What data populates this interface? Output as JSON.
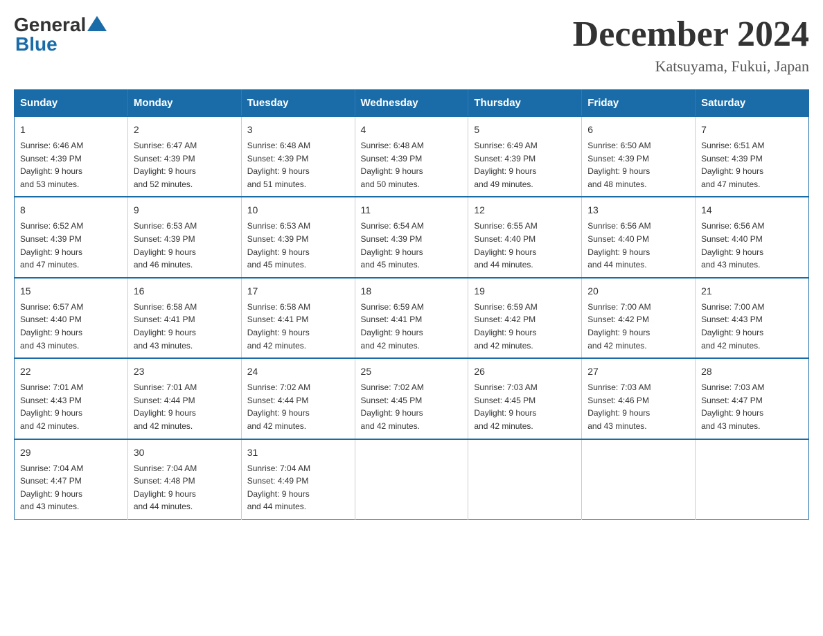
{
  "logo": {
    "general": "General",
    "blue": "Blue"
  },
  "title": "December 2024",
  "location": "Katsuyama, Fukui, Japan",
  "headers": [
    "Sunday",
    "Monday",
    "Tuesday",
    "Wednesday",
    "Thursday",
    "Friday",
    "Saturday"
  ],
  "weeks": [
    [
      {
        "day": "1",
        "info": "Sunrise: 6:46 AM\nSunset: 4:39 PM\nDaylight: 9 hours\nand 53 minutes."
      },
      {
        "day": "2",
        "info": "Sunrise: 6:47 AM\nSunset: 4:39 PM\nDaylight: 9 hours\nand 52 minutes."
      },
      {
        "day": "3",
        "info": "Sunrise: 6:48 AM\nSunset: 4:39 PM\nDaylight: 9 hours\nand 51 minutes."
      },
      {
        "day": "4",
        "info": "Sunrise: 6:48 AM\nSunset: 4:39 PM\nDaylight: 9 hours\nand 50 minutes."
      },
      {
        "day": "5",
        "info": "Sunrise: 6:49 AM\nSunset: 4:39 PM\nDaylight: 9 hours\nand 49 minutes."
      },
      {
        "day": "6",
        "info": "Sunrise: 6:50 AM\nSunset: 4:39 PM\nDaylight: 9 hours\nand 48 minutes."
      },
      {
        "day": "7",
        "info": "Sunrise: 6:51 AM\nSunset: 4:39 PM\nDaylight: 9 hours\nand 47 minutes."
      }
    ],
    [
      {
        "day": "8",
        "info": "Sunrise: 6:52 AM\nSunset: 4:39 PM\nDaylight: 9 hours\nand 47 minutes."
      },
      {
        "day": "9",
        "info": "Sunrise: 6:53 AM\nSunset: 4:39 PM\nDaylight: 9 hours\nand 46 minutes."
      },
      {
        "day": "10",
        "info": "Sunrise: 6:53 AM\nSunset: 4:39 PM\nDaylight: 9 hours\nand 45 minutes."
      },
      {
        "day": "11",
        "info": "Sunrise: 6:54 AM\nSunset: 4:39 PM\nDaylight: 9 hours\nand 45 minutes."
      },
      {
        "day": "12",
        "info": "Sunrise: 6:55 AM\nSunset: 4:40 PM\nDaylight: 9 hours\nand 44 minutes."
      },
      {
        "day": "13",
        "info": "Sunrise: 6:56 AM\nSunset: 4:40 PM\nDaylight: 9 hours\nand 44 minutes."
      },
      {
        "day": "14",
        "info": "Sunrise: 6:56 AM\nSunset: 4:40 PM\nDaylight: 9 hours\nand 43 minutes."
      }
    ],
    [
      {
        "day": "15",
        "info": "Sunrise: 6:57 AM\nSunset: 4:40 PM\nDaylight: 9 hours\nand 43 minutes."
      },
      {
        "day": "16",
        "info": "Sunrise: 6:58 AM\nSunset: 4:41 PM\nDaylight: 9 hours\nand 43 minutes."
      },
      {
        "day": "17",
        "info": "Sunrise: 6:58 AM\nSunset: 4:41 PM\nDaylight: 9 hours\nand 42 minutes."
      },
      {
        "day": "18",
        "info": "Sunrise: 6:59 AM\nSunset: 4:41 PM\nDaylight: 9 hours\nand 42 minutes."
      },
      {
        "day": "19",
        "info": "Sunrise: 6:59 AM\nSunset: 4:42 PM\nDaylight: 9 hours\nand 42 minutes."
      },
      {
        "day": "20",
        "info": "Sunrise: 7:00 AM\nSunset: 4:42 PM\nDaylight: 9 hours\nand 42 minutes."
      },
      {
        "day": "21",
        "info": "Sunrise: 7:00 AM\nSunset: 4:43 PM\nDaylight: 9 hours\nand 42 minutes."
      }
    ],
    [
      {
        "day": "22",
        "info": "Sunrise: 7:01 AM\nSunset: 4:43 PM\nDaylight: 9 hours\nand 42 minutes."
      },
      {
        "day": "23",
        "info": "Sunrise: 7:01 AM\nSunset: 4:44 PM\nDaylight: 9 hours\nand 42 minutes."
      },
      {
        "day": "24",
        "info": "Sunrise: 7:02 AM\nSunset: 4:44 PM\nDaylight: 9 hours\nand 42 minutes."
      },
      {
        "day": "25",
        "info": "Sunrise: 7:02 AM\nSunset: 4:45 PM\nDaylight: 9 hours\nand 42 minutes."
      },
      {
        "day": "26",
        "info": "Sunrise: 7:03 AM\nSunset: 4:45 PM\nDaylight: 9 hours\nand 42 minutes."
      },
      {
        "day": "27",
        "info": "Sunrise: 7:03 AM\nSunset: 4:46 PM\nDaylight: 9 hours\nand 43 minutes."
      },
      {
        "day": "28",
        "info": "Sunrise: 7:03 AM\nSunset: 4:47 PM\nDaylight: 9 hours\nand 43 minutes."
      }
    ],
    [
      {
        "day": "29",
        "info": "Sunrise: 7:04 AM\nSunset: 4:47 PM\nDaylight: 9 hours\nand 43 minutes."
      },
      {
        "day": "30",
        "info": "Sunrise: 7:04 AM\nSunset: 4:48 PM\nDaylight: 9 hours\nand 44 minutes."
      },
      {
        "day": "31",
        "info": "Sunrise: 7:04 AM\nSunset: 4:49 PM\nDaylight: 9 hours\nand 44 minutes."
      },
      {
        "day": "",
        "info": ""
      },
      {
        "day": "",
        "info": ""
      },
      {
        "day": "",
        "info": ""
      },
      {
        "day": "",
        "info": ""
      }
    ]
  ]
}
